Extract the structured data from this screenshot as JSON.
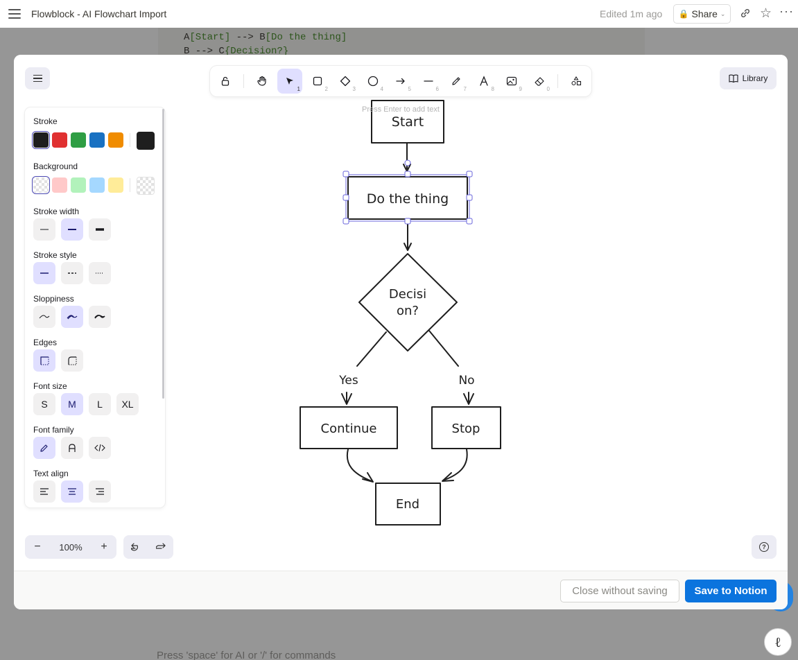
{
  "page": {
    "title": "Flowblock - AI Flowchart Import",
    "edited": "Edited 1m ago",
    "share_label": "Share",
    "code_lines": [
      {
        "a": "A",
        "b": "[Start]",
        "c": " --> ",
        "d": "B",
        "e": "[Do the thing]"
      },
      {
        "a": "B",
        "b": "",
        "c": " --> ",
        "d": "C",
        "e": "{Decision?}"
      }
    ],
    "bottom_hint": "Press 'space' for AI or '/' for commands"
  },
  "toolbar": {
    "tools": [
      {
        "name": "lock",
        "key": ""
      },
      {
        "name": "hand",
        "key": ""
      },
      {
        "name": "selection",
        "key": "1"
      },
      {
        "name": "rectangle",
        "key": "2"
      },
      {
        "name": "diamond",
        "key": "3"
      },
      {
        "name": "ellipse",
        "key": "4"
      },
      {
        "name": "arrow",
        "key": "5"
      },
      {
        "name": "line",
        "key": "6"
      },
      {
        "name": "draw",
        "key": "7"
      },
      {
        "name": "text",
        "key": "8"
      },
      {
        "name": "image",
        "key": "9"
      },
      {
        "name": "eraser",
        "key": "0"
      },
      {
        "name": "more-tools",
        "key": ""
      }
    ],
    "active_tool": "selection",
    "library_label": "Library"
  },
  "properties": {
    "stroke_label": "Stroke",
    "stroke_colors": [
      "#1e1e1e",
      "#e03131",
      "#2f9e44",
      "#1971c2",
      "#f08c00"
    ],
    "stroke_current": "#1e1e1e",
    "background_label": "Background",
    "background_colors": [
      "transparent",
      "#ffc9c9",
      "#b2f2bb",
      "#a5d8ff",
      "#ffec99"
    ],
    "background_current": "transparent",
    "stroke_width_label": "Stroke width",
    "stroke_style_label": "Stroke style",
    "sloppiness_label": "Sloppiness",
    "edges_label": "Edges",
    "font_size_label": "Font size",
    "font_sizes": [
      "S",
      "M",
      "L",
      "XL"
    ],
    "font_size_selected": "M",
    "font_family_label": "Font family",
    "text_align_label": "Text align"
  },
  "canvas": {
    "enter_hint": "Press Enter to add text",
    "nodes": {
      "start": "Start",
      "do_thing": "Do the thing",
      "decision_line1": "Decisi",
      "decision_line2": "on?",
      "continue": "Continue",
      "stop": "Stop",
      "end": "End"
    },
    "edge_labels": {
      "yes": "Yes",
      "no": "No"
    },
    "selected_node": "Do the thing"
  },
  "zoom": {
    "level": "100%",
    "minus": "−",
    "plus": "+"
  },
  "footer": {
    "close_label": "Close without saving",
    "save_label": "Save to Notion"
  },
  "colors": {
    "accent": "#0b74de",
    "selection": "#6965db",
    "active_tool_bg": "#e0dfff"
  }
}
